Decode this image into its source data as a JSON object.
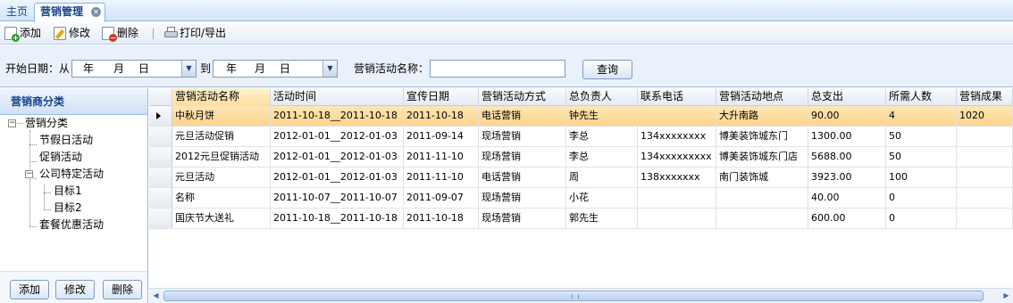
{
  "tabs": {
    "home": "主页",
    "active": "营销管理"
  },
  "toolbar": {
    "add": "添加",
    "edit": "修改",
    "delete": "删除",
    "print_export": "打印/导出"
  },
  "search": {
    "start_date_label": "开始日期：从",
    "from_date": {
      "year": "年",
      "month": "月",
      "day": "日"
    },
    "to_label": "到",
    "to_date": {
      "year": "年",
      "month": "月",
      "day": "日"
    },
    "activity_name_label": "营销活动名称：",
    "activity_name_value": "",
    "query_button": "查询"
  },
  "left_panel": {
    "title": "营销商分类",
    "tree": [
      {
        "label": "营销分类",
        "level": 0,
        "expanded": true
      },
      {
        "label": "节假日活动",
        "level": 1
      },
      {
        "label": "促销活动",
        "level": 1
      },
      {
        "label": "公司特定活动",
        "level": 1,
        "expanded": true
      },
      {
        "label": "目标1",
        "level": 2
      },
      {
        "label": "目标2",
        "level": 2
      },
      {
        "label": "套餐优惠活动",
        "level": 1
      }
    ],
    "buttons": {
      "add": "添加",
      "edit": "修改",
      "delete": "删除"
    }
  },
  "grid": {
    "columns": [
      "营销活动名称",
      "活动时间",
      "宣传日期",
      "营销活动方式",
      "总负责人",
      "联系电话",
      "营销活动地点",
      "总支出",
      "所需人数",
      "营销成果"
    ],
    "rows": [
      [
        "中秋月饼",
        "2011-10-18__2011-10-18",
        "2011-10-18",
        "电话营销",
        "钟先生",
        "",
        "大升南路",
        "90.00",
        "4",
        "1020"
      ],
      [
        "元旦活动促销",
        "2012-01-01__2012-01-03",
        "2011-09-14",
        "现场营销",
        "李总",
        "134xxxxxxxx",
        "博美装饰城东门",
        "1300.00",
        "50",
        ""
      ],
      [
        "2012元旦促销活动",
        "2012-01-01__2012-01-03",
        "2011-11-10",
        "现场营销",
        "李总",
        "134xxxxxxxxx",
        "博美装饰城东门店",
        "5688.00",
        "50",
        ""
      ],
      [
        "元旦活动",
        "2012-01-01__2012-01-03",
        "2011-11-10",
        "电话营销",
        "周",
        "138xxxxxxx",
        "南门装饰城",
        "3923.00",
        "100",
        ""
      ],
      [
        "名称",
        "2011-10-07__2011-10-07",
        "2011-09-07",
        "现场营销",
        "小花",
        "",
        "",
        "40.00",
        "0",
        ""
      ],
      [
        "国庆节大送礼",
        "2011-10-18__2011-10-18",
        "2011-10-18",
        "现场营销",
        "郭先生",
        "",
        "",
        "600.00",
        "0",
        ""
      ]
    ],
    "selected_row": 0
  },
  "colors": {
    "accent": "#15428b",
    "header_bg": "#d3e4f7",
    "selected_row": "#ffd48a"
  }
}
